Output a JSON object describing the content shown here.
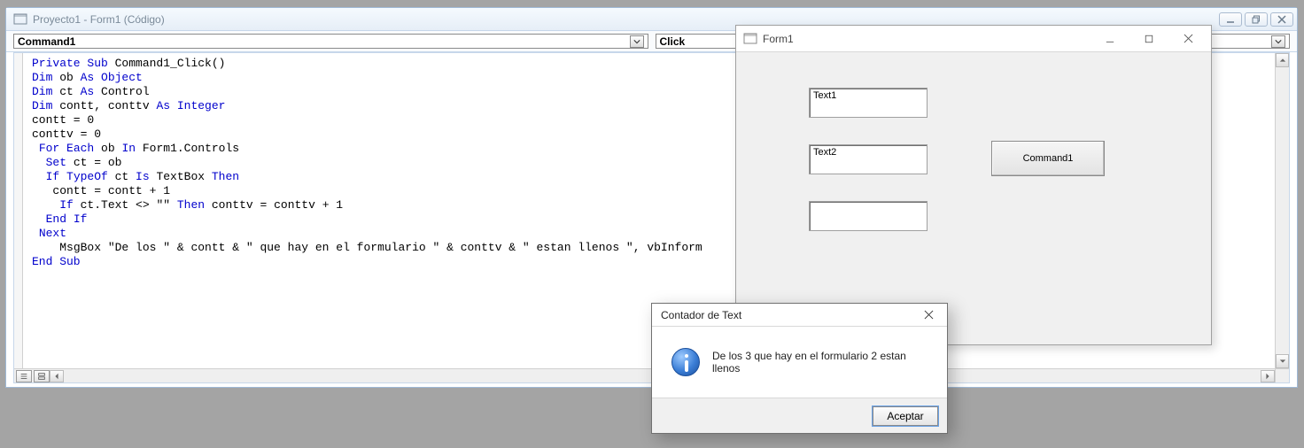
{
  "mdi": {
    "title": "Proyecto1 - Form1 (Código)",
    "object_combo": "Command1",
    "proc_combo": "Click"
  },
  "code": {
    "lines": [
      {
        "indent": 0,
        "tokens": [
          {
            "t": "Private Sub",
            "k": true
          },
          {
            "t": " Command1_Click()"
          }
        ]
      },
      {
        "indent": 0,
        "tokens": [
          {
            "t": "Dim",
            "k": true
          },
          {
            "t": " ob "
          },
          {
            "t": "As Object",
            "k": true
          }
        ]
      },
      {
        "indent": 0,
        "tokens": [
          {
            "t": "Dim",
            "k": true
          },
          {
            "t": " ct "
          },
          {
            "t": "As",
            "k": true
          },
          {
            "t": " Control"
          }
        ]
      },
      {
        "indent": 0,
        "tokens": [
          {
            "t": "Dim",
            "k": true
          },
          {
            "t": " contt, conttv "
          },
          {
            "t": "As Integer",
            "k": true
          }
        ]
      },
      {
        "indent": 0,
        "tokens": []
      },
      {
        "indent": 0,
        "tokens": [
          {
            "t": "contt = 0"
          }
        ]
      },
      {
        "indent": 0,
        "tokens": [
          {
            "t": "conttv = 0"
          }
        ]
      },
      {
        "indent": 1,
        "tokens": [
          {
            "t": "For Each",
            "k": true
          },
          {
            "t": " ob "
          },
          {
            "t": "In",
            "k": true
          },
          {
            "t": " Form1.Controls"
          }
        ]
      },
      {
        "indent": 0,
        "tokens": []
      },
      {
        "indent": 2,
        "tokens": [
          {
            "t": "Set",
            "k": true
          },
          {
            "t": " ct = ob"
          }
        ]
      },
      {
        "indent": 2,
        "tokens": [
          {
            "t": "If TypeOf",
            "k": true
          },
          {
            "t": " ct "
          },
          {
            "t": "Is",
            "k": true
          },
          {
            "t": " TextBox "
          },
          {
            "t": "Then",
            "k": true
          }
        ]
      },
      {
        "indent": 3,
        "tokens": [
          {
            "t": "contt = contt + 1"
          }
        ]
      },
      {
        "indent": 4,
        "tokens": [
          {
            "t": "If",
            "k": true
          },
          {
            "t": " ct.Text <> \"\" "
          },
          {
            "t": "Then",
            "k": true
          },
          {
            "t": " conttv = conttv + 1"
          }
        ]
      },
      {
        "indent": 2,
        "tokens": [
          {
            "t": "End If",
            "k": true
          }
        ]
      },
      {
        "indent": 1,
        "tokens": [
          {
            "t": "Next",
            "k": true
          }
        ]
      },
      {
        "indent": 4,
        "tokens": [
          {
            "t": "MsgBox \"De los \" & contt & \" que hay en el formulario \" & conttv & \" estan llenos \", vbInform"
          }
        ]
      },
      {
        "indent": 0,
        "tokens": [
          {
            "t": "End Sub",
            "k": true
          }
        ]
      }
    ]
  },
  "form1": {
    "title": "Form1",
    "text1": "Text1",
    "text2": "Text2",
    "text3": "",
    "command1": "Command1"
  },
  "msgbox": {
    "title": "Contador de Text",
    "message": "De los 3 que hay en el formulario 2 estan llenos",
    "ok_label": "Aceptar"
  }
}
